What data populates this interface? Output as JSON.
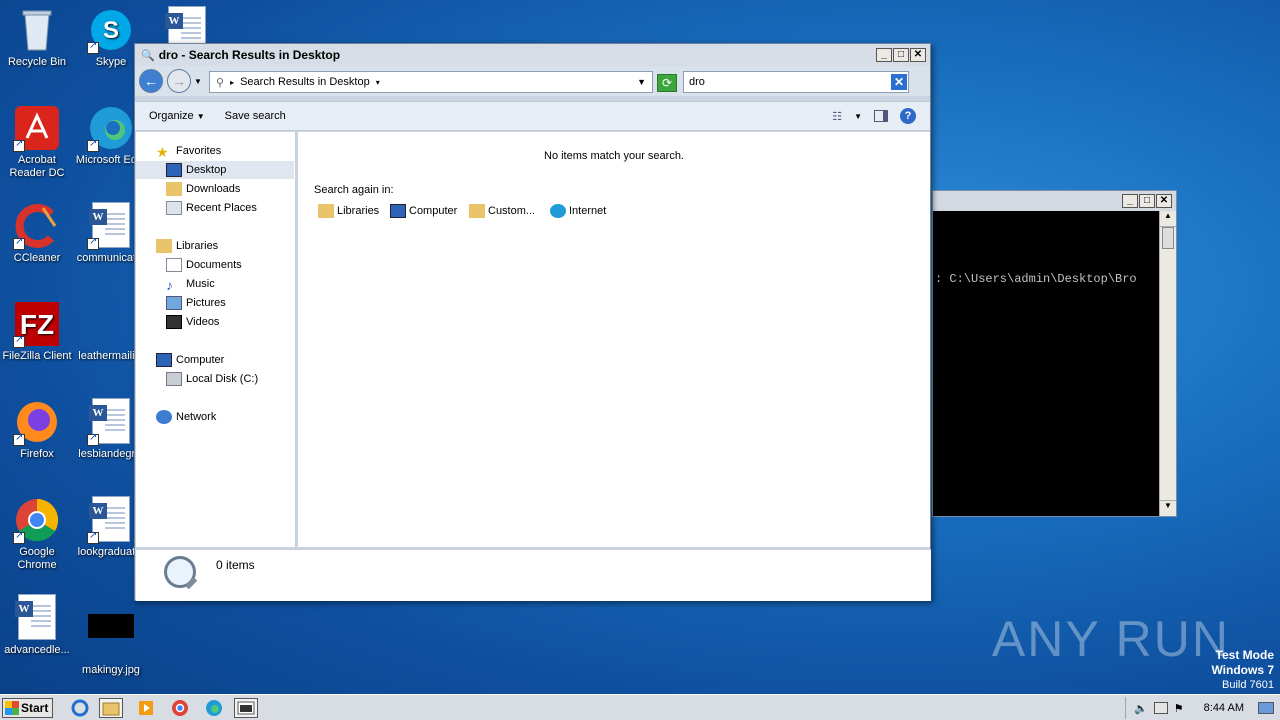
{
  "desktop": {
    "icons": [
      {
        "label": "Recycle Bin"
      },
      {
        "label": "Skype"
      },
      {
        "label": "Acrobat Reader DC"
      },
      {
        "label": "Microsoft Ed..."
      },
      {
        "label": "CCleaner"
      },
      {
        "label": "communicat..."
      },
      {
        "label": "FileZilla Client"
      },
      {
        "label": "leathermaili..."
      },
      {
        "label": "Firefox"
      },
      {
        "label": "lesbiandegr..."
      },
      {
        "label": "Google Chrome"
      },
      {
        "label": "lookgraduat..."
      },
      {
        "label": "advancedle..."
      },
      {
        "label": "makingy.jpg"
      }
    ]
  },
  "explorer": {
    "title": "dro - Search Results in Desktop",
    "address": "Search Results in Desktop",
    "search_value": "dro",
    "toolbar": {
      "organize": "Organize",
      "save_search": "Save search"
    },
    "nav": {
      "favorites": "Favorites",
      "desktop": "Desktop",
      "downloads": "Downloads",
      "recent_places": "Recent Places",
      "libraries": "Libraries",
      "documents": "Documents",
      "music": "Music",
      "pictures": "Pictures",
      "videos": "Videos",
      "computer": "Computer",
      "local_disk": "Local Disk (C:)",
      "network": "Network"
    },
    "content": {
      "no_items": "No items match your search.",
      "search_again_label": "Search again in:",
      "locations": [
        "Libraries",
        "Computer",
        "Custom...",
        "Internet"
      ]
    },
    "status": {
      "count": "0 items"
    }
  },
  "console": {
    "line": ": C:\\Users\\admin\\Desktop\\Bro"
  },
  "taskbar": {
    "start": "Start",
    "clock": "8:44 AM"
  },
  "watermark": {
    "brand": "ANY RUN",
    "mode": "Test Mode",
    "os": "Windows 7",
    "build": "Build 7601"
  }
}
